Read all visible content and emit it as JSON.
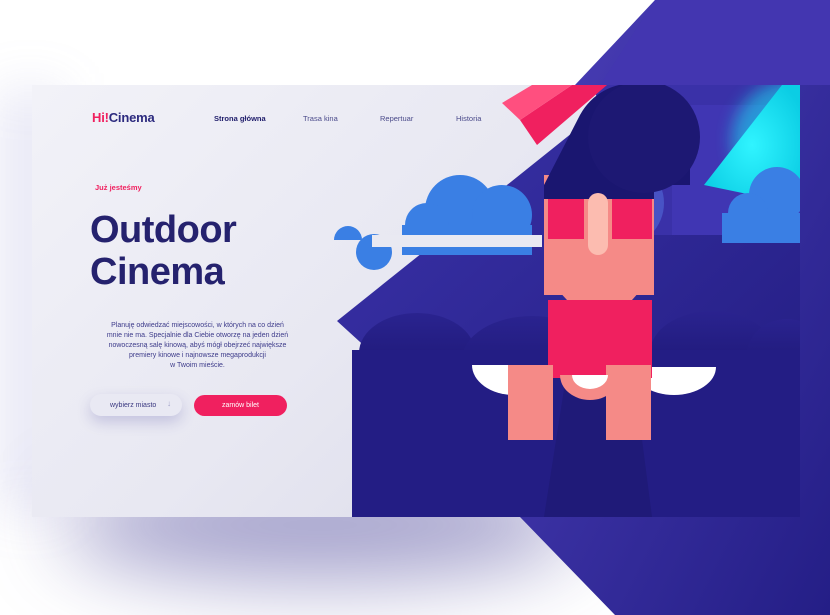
{
  "header": {
    "logo_prefix": "Hi!",
    "logo_name": "Cinema",
    "nav": [
      {
        "label": "Strona główna",
        "active": true
      },
      {
        "label": "Trasa kina",
        "active": false
      },
      {
        "label": "Repertuar",
        "active": false
      },
      {
        "label": "Historia",
        "active": false
      }
    ]
  },
  "hero": {
    "eyebrow": "Już jesteśmy",
    "title_line1": "Outdoor",
    "title_line2": "Cinema",
    "description_lines": [
      "Planuję odwiedzać miejscowości, w których na co dzień",
      "mnie nie ma. Specjalnie dla Ciebie otworzę na jeden dzień",
      "nowoczesną salę kinową, abyś mógł obejrzeć największe",
      "premiery kinowe i najnowsze megaprodukcji",
      " w Twoim mieście."
    ]
  },
  "actions": {
    "city_button": "wybierz miasto",
    "city_icon": "arrow-down-icon",
    "ticket_button": "zamów bilet"
  },
  "colors": {
    "accent": "#f0205f",
    "brand_dark": "#25226e",
    "art_blue": "#2a2590",
    "art_cyan": "#14e5f5"
  }
}
